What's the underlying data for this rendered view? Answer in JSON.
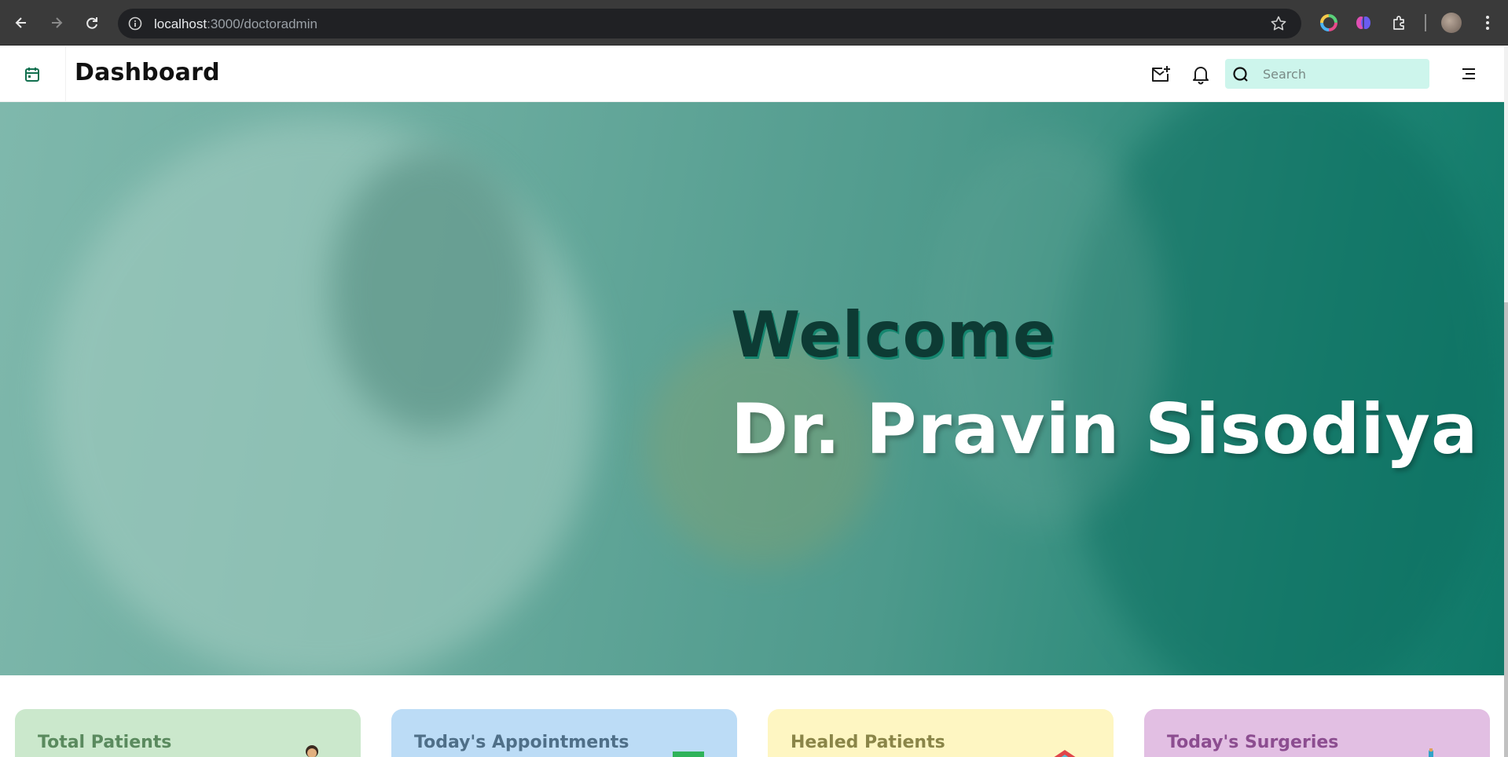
{
  "browser": {
    "url_host": "localhost",
    "url_path": ":3000/doctoradmin"
  },
  "header": {
    "title": "Dashboard",
    "search_placeholder": "Search"
  },
  "hero": {
    "welcome": "Welcome",
    "name": "Dr. Pravin Sisodiya"
  },
  "cards": [
    {
      "label": "Total Patients",
      "bg": "#cbe8cc",
      "color": "#5a8a5e"
    },
    {
      "label": "Today's Appointments",
      "bg": "#bcdcf6",
      "color": "#4f6f88"
    },
    {
      "label": "Healed Patients",
      "bg": "#fef6c2",
      "color": "#8a8548"
    },
    {
      "label": "Today's Surgeries",
      "bg": "#e2bfe3",
      "color": "#8c4d90"
    }
  ],
  "colors": {
    "accent": "#12704f",
    "search_bg": "#cdf5ec"
  },
  "icons": [
    "back-icon",
    "forward-icon",
    "reload-icon",
    "info-icon",
    "star-icon",
    "calendar-icon",
    "mail-add-icon",
    "bell-icon",
    "search-icon",
    "menu-icon"
  ]
}
